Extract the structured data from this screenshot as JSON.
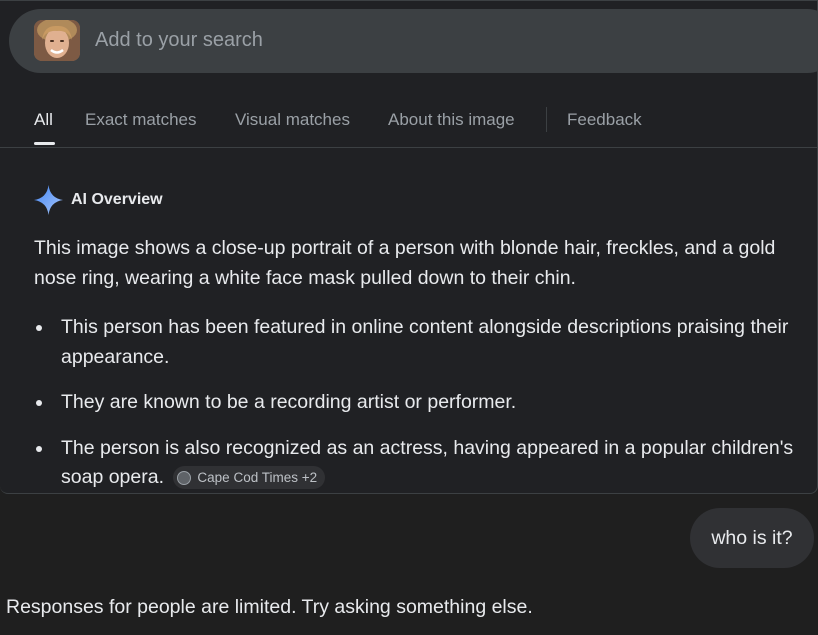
{
  "search": {
    "placeholder": "Add to your search"
  },
  "tabs": [
    {
      "label": "All",
      "active": true
    },
    {
      "label": "Exact matches",
      "active": false
    },
    {
      "label": "Visual matches",
      "active": false
    },
    {
      "label": "About this image",
      "active": false
    },
    {
      "label": "Feedback",
      "active": false
    }
  ],
  "ai_overview": {
    "title": "AI Overview",
    "summary": "This image shows a close-up portrait of a person with blonde hair, freckles, and a gold nose ring, wearing a white face mask pulled down to their chin.",
    "bullets": [
      "This person has been featured in online content alongside descriptions praising their appearance.",
      "They are known to be a recording artist or performer.",
      "The person is also recognized as an actress, having appeared in a popular children's soap opera."
    ],
    "source_chip": "Cape Cod Times +2"
  },
  "chat": {
    "user_message": "who is it?",
    "response": "Responses for people are limited. Try asking something else."
  },
  "colors": {
    "background": "#1f1f1f",
    "panel": "#202124",
    "searchbar": "#3c4043",
    "sparkle_start": "#4285f4",
    "sparkle_end": "#a8c7fa"
  },
  "icons": {
    "avatar": "user-photo-thumbnail",
    "ai": "sparkle-icon",
    "source": "globe-icon"
  }
}
